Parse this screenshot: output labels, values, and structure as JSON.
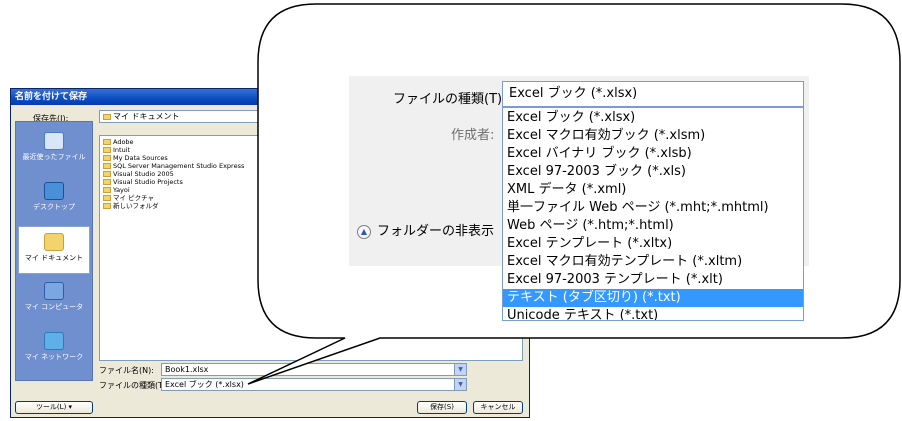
{
  "dialog": {
    "title": "名前を付けて保存",
    "save_in_label": "保存先(I):",
    "save_in_value": "マイ ドキュメント",
    "places": [
      {
        "label": "最近使ったファイル",
        "icon": "recent-icon"
      },
      {
        "label": "デスクトップ",
        "icon": "desktop-icon"
      },
      {
        "label": "マイ ドキュメント",
        "icon": "my-documents-icon"
      },
      {
        "label": "マイ コンピュータ",
        "icon": "my-computer-icon"
      },
      {
        "label": "マイ ネットワーク",
        "icon": "my-network-icon"
      }
    ],
    "files": [
      "Adobe",
      "Intuit",
      "My Data Sources",
      "SQL Server Management Studio Express",
      "Visual Studio 2005",
      "Visual Studio Projects",
      "Yayoi",
      "マイ ピクチャ",
      "新しいフォルダ"
    ],
    "filename_label": "ファイル名(N):",
    "filename_value": "Book1.xlsx",
    "filetype_label": "ファイルの種類(T):",
    "filetype_value": "Excel ブック (*.xlsx)",
    "tools_label": "ツール(L)",
    "save_label": "保存(S)",
    "cancel_label": "キャンセル"
  },
  "zoom": {
    "filetype_label": "ファイルの種類(T):",
    "filetype_value": "Excel ブック (*.xlsx)",
    "author_label": "作成者:",
    "hide_folders_label": "フォルダーの非表示",
    "options": [
      "Excel ブック (*.xlsx)",
      "Excel マクロ有効ブック (*.xlsm)",
      "Excel バイナリ ブック (*.xlsb)",
      "Excel 97-2003 ブック (*.xls)",
      "XML データ (*.xml)",
      "単一ファイル Web ページ (*.mht;*.mhtml)",
      "Web ページ (*.htm;*.html)",
      "Excel テンプレート (*.xltx)",
      "Excel マクロ有効テンプレート (*.xltm)",
      "Excel 97-2003 テンプレート (*.xlt)",
      "テキスト (タブ区切り) (*.txt)",
      "Unicode テキスト (*.txt)"
    ],
    "selected_index": 10
  },
  "colors": {
    "selection": "#3399ff",
    "xp_title": "#0a4ec2",
    "places_bar": "#6f8fcf"
  }
}
